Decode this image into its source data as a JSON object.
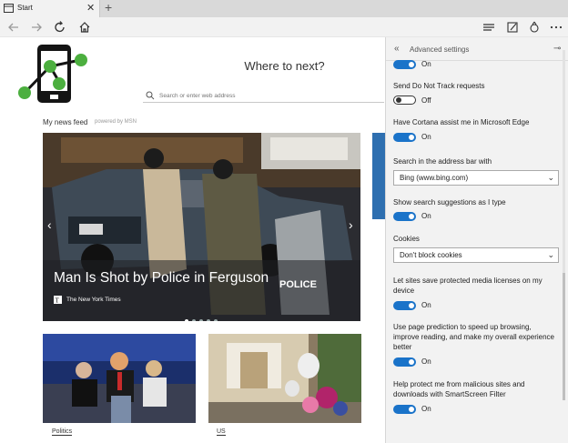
{
  "tab": {
    "title": "Start",
    "close": "✕",
    "new_tab": "+"
  },
  "toolbar": {
    "icons": [
      "back-icon",
      "forward-icon",
      "refresh-icon",
      "home-icon",
      "hub-icon",
      "web-note-icon",
      "share-icon",
      "more-icon"
    ]
  },
  "main": {
    "heading": "Where to next?",
    "search_placeholder": "Search or enter web address",
    "feed_title": "My news feed",
    "feed_powered": "powered by MSN",
    "hero": {
      "headline": "Man Is Shot by Police in Ferguson",
      "source": "The New York Times",
      "prev": "‹",
      "next": "›",
      "police_text": "POLICE"
    },
    "cards": [
      {
        "label": "Politics"
      },
      {
        "label": "US"
      }
    ]
  },
  "panel": {
    "title": "Advanced settings",
    "back_glyph": "«",
    "pin_glyph": "⊸",
    "top_toggle": {
      "state": "On"
    },
    "settings": [
      {
        "label": "Send Do Not Track requests",
        "type": "toggle",
        "on": false,
        "state": "Off"
      },
      {
        "label": "Have Cortana assist me in Microsoft Edge",
        "type": "toggle",
        "on": true,
        "state": "On"
      },
      {
        "label": "Search in the address bar with",
        "type": "dropdown",
        "value": "Bing (www.bing.com)"
      },
      {
        "label": "Show search suggestions as I type",
        "type": "toggle",
        "on": true,
        "state": "On"
      },
      {
        "label": "Cookies",
        "type": "dropdown",
        "value": "Don't block cookies"
      },
      {
        "label": "Let sites save protected media licenses on my device",
        "type": "toggle",
        "on": true,
        "state": "On"
      },
      {
        "label": "Use page prediction to speed up browsing, improve reading, and make my overall experience better",
        "type": "toggle",
        "on": true,
        "state": "On"
      },
      {
        "label": "Help protect me from malicious sites and downloads with SmartScreen Filter",
        "type": "toggle",
        "on": true,
        "state": "On"
      }
    ]
  },
  "colors": {
    "accent": "#1a73c9",
    "panel_bg": "#f2f2f2",
    "logo_green": "#4caf3f"
  }
}
